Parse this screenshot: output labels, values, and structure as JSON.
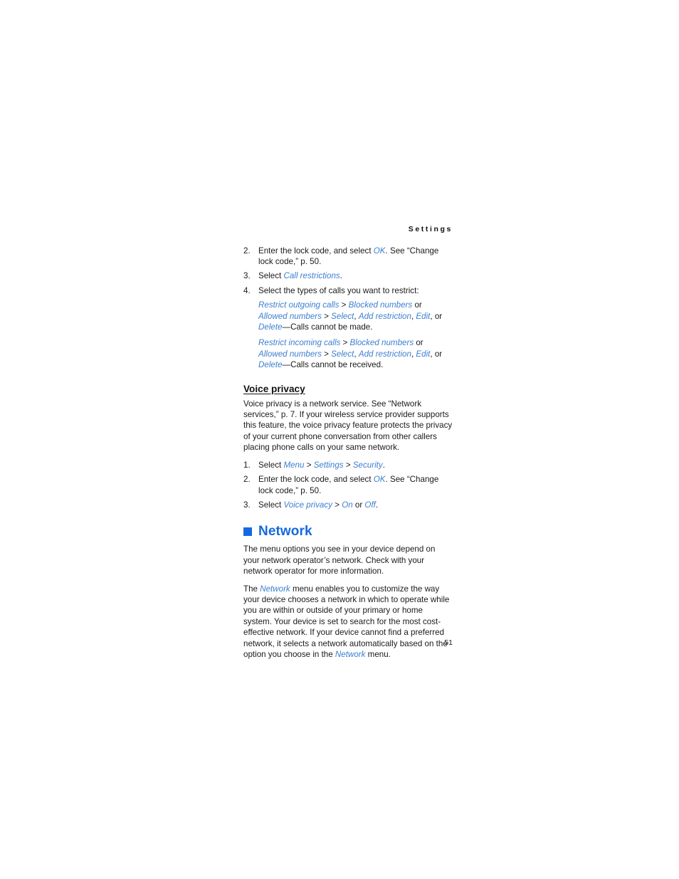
{
  "page": {
    "running_head": "Settings",
    "folio": "51",
    "accent_blue": "#1569e0",
    "link_blue": "#3c7fd0",
    "text_color": "#1a1a1a"
  },
  "call_restrictions_steps": [
    {
      "num": "2.",
      "segments": [
        {
          "text": "Enter the lock code, and select ",
          "style": "plain"
        },
        {
          "text": "OK",
          "style": "italic"
        },
        {
          "text": ". See “Change lock code,” p. 50.",
          "style": "plain"
        }
      ]
    },
    {
      "num": "3.",
      "segments": [
        {
          "text": "Select ",
          "style": "plain"
        },
        {
          "text": "Call restrictions",
          "style": "italic"
        },
        {
          "text": ".",
          "style": "plain"
        }
      ]
    },
    {
      "num": "4.",
      "segments": [
        {
          "text": "Select the types of calls you want to restrict:",
          "style": "plain"
        }
      ]
    }
  ],
  "restriction_blocks": [
    {
      "segments": [
        {
          "text": "Restrict outgoing calls",
          "style": "italic"
        },
        {
          "text": " > ",
          "style": "plain"
        },
        {
          "text": "Blocked numbers",
          "style": "italic"
        },
        {
          "text": " or ",
          "style": "plain"
        },
        {
          "text": "Allowed numbers",
          "style": "italic"
        },
        {
          "text": " > ",
          "style": "plain"
        },
        {
          "text": "Select",
          "style": "italic"
        },
        {
          "text": ", ",
          "style": "plain"
        },
        {
          "text": "Add restriction",
          "style": "italic"
        },
        {
          "text": ", ",
          "style": "plain"
        },
        {
          "text": "Edit",
          "style": "italic"
        },
        {
          "text": ", or ",
          "style": "plain"
        },
        {
          "text": "Delete",
          "style": "italic"
        },
        {
          "text": "—Calls cannot be made.",
          "style": "plain"
        }
      ]
    },
    {
      "segments": [
        {
          "text": "Restrict incoming calls",
          "style": "italic"
        },
        {
          "text": " > ",
          "style": "plain"
        },
        {
          "text": "Blocked numbers",
          "style": "italic"
        },
        {
          "text": " or ",
          "style": "plain"
        },
        {
          "text": "Allowed numbers",
          "style": "italic"
        },
        {
          "text": " > ",
          "style": "plain"
        },
        {
          "text": "Select",
          "style": "italic"
        },
        {
          "text": ", ",
          "style": "plain"
        },
        {
          "text": "Add restriction",
          "style": "italic"
        },
        {
          "text": ", ",
          "style": "plain"
        },
        {
          "text": "Edit",
          "style": "italic"
        },
        {
          "text": ", or ",
          "style": "plain"
        },
        {
          "text": "Delete",
          "style": "italic"
        },
        {
          "text": "—Calls cannot be received.",
          "style": "plain"
        }
      ]
    }
  ],
  "voice_privacy": {
    "heading": "Voice privacy",
    "paragraph": "Voice privacy is a network service. See “Network services,” p. 7. If your wireless service provider supports this feature, the voice privacy feature protects the privacy of your current phone conversation from other callers placing phone calls on your same network.",
    "steps": [
      {
        "num": "1.",
        "segments": [
          {
            "text": "Select ",
            "style": "plain"
          },
          {
            "text": "Menu",
            "style": "italic"
          },
          {
            "text": " > ",
            "style": "plain"
          },
          {
            "text": "Settings",
            "style": "italic"
          },
          {
            "text": " > ",
            "style": "plain"
          },
          {
            "text": "Security",
            "style": "italic"
          },
          {
            "text": ".",
            "style": "plain"
          }
        ]
      },
      {
        "num": "2.",
        "segments": [
          {
            "text": "Enter the lock code, and select ",
            "style": "plain"
          },
          {
            "text": "OK",
            "style": "italic"
          },
          {
            "text": ". See “Change lock code,” p. 50.",
            "style": "plain"
          }
        ]
      },
      {
        "num": "3.",
        "segments": [
          {
            "text": "Select ",
            "style": "plain"
          },
          {
            "text": "Voice privacy",
            "style": "italic"
          },
          {
            "text": " > ",
            "style": "plain"
          },
          {
            "text": "On",
            "style": "italic"
          },
          {
            "text": " or ",
            "style": "plain"
          },
          {
            "text": "Off",
            "style": "italic"
          },
          {
            "text": ".",
            "style": "plain"
          }
        ]
      }
    ]
  },
  "network": {
    "heading": "Network",
    "paragraph1": "The menu options you see in your device depend on your network operator’s network. Check with your network operator for more information.",
    "paragraph2_segments": [
      {
        "text": "The ",
        "style": "plain"
      },
      {
        "text": "Network",
        "style": "italic"
      },
      {
        "text": " menu enables you to customize the way your device chooses a network in which to operate while you are within or outside of your primary or home system. Your device is set to search for the most cost-effective network. If your device cannot find a preferred network, it selects a network automatically based on the option you choose in the ",
        "style": "plain"
      },
      {
        "text": "Network",
        "style": "italic"
      },
      {
        "text": " menu.",
        "style": "plain"
      }
    ]
  }
}
